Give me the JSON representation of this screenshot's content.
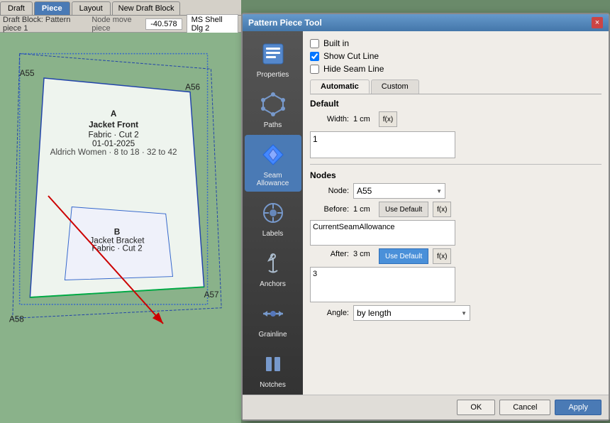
{
  "tabs": {
    "items": [
      "Draft",
      "Piece",
      "Layout"
    ],
    "active": "Piece",
    "new_block": "New Draft Block"
  },
  "toolbar": {
    "draft_block_label": "Draft Block: Pattern piece 1",
    "node_move": "Node move piece",
    "zoom_value": "-40.578",
    "font_label": "MS Shell Dlg 2"
  },
  "dialog": {
    "title": "Pattern Piece Tool",
    "close_label": "×",
    "checkboxes": {
      "built_in": {
        "label": "Built in",
        "checked": false
      },
      "show_cut_line": {
        "label": "Show Cut Line",
        "checked": true
      },
      "hide_seam_line": {
        "label": "Hide Seam Line",
        "checked": false
      }
    },
    "content_tabs": [
      "Automatic",
      "Custom"
    ],
    "active_content_tab": "Automatic",
    "default_section": {
      "title": "Default",
      "width_label": "Width:",
      "width_value": "1 cm",
      "formula_label": "f(x)",
      "input_value": "1"
    },
    "nodes_section": {
      "title": "Nodes",
      "node_label": "Node:",
      "node_value": "A55",
      "before_label": "Before:",
      "before_value": "1 cm",
      "use_default_before": "Use Default",
      "formula_label_before": "f(x)",
      "before_formula": "CurrentSeamAllowance",
      "after_label": "After:",
      "after_value": "3 cm",
      "use_default_after": "Use Default",
      "formula_label_after": "f(x)",
      "after_input": "3",
      "angle_label": "Angle:",
      "angle_value": "by length"
    },
    "footer": {
      "ok_label": "OK",
      "cancel_label": "Cancel",
      "apply_label": "Apply"
    }
  },
  "sidebar": {
    "items": [
      {
        "id": "properties",
        "label": "Properties",
        "icon": "📋"
      },
      {
        "id": "paths",
        "label": "Paths",
        "icon": "⬡"
      },
      {
        "id": "seam-allowance",
        "label": "Seam Allowance",
        "icon": "▶"
      },
      {
        "id": "labels",
        "label": "Labels",
        "icon": "⚙"
      },
      {
        "id": "anchors",
        "label": "Anchors",
        "icon": "✒"
      },
      {
        "id": "grainline",
        "label": "Grainline",
        "icon": "↔"
      },
      {
        "id": "notches",
        "label": "Notches",
        "icon": "⏸"
      }
    ],
    "active": "seam-allowance"
  },
  "canvas": {
    "piece_title": "A",
    "piece_name": "Jacket Front",
    "piece_fabric": "Fabric · Cut 2",
    "piece_date": "01-01-2025",
    "piece_extra": "Aldrich Women · 8 to 18 · 32 to 42",
    "node_labels": [
      "A55",
      "A56",
      "A57",
      "A58"
    ],
    "piece_label_b": "B",
    "piece_name_b": "Jacket Bracket",
    "piece_fabric_b": "Fabric · Cut 2"
  }
}
